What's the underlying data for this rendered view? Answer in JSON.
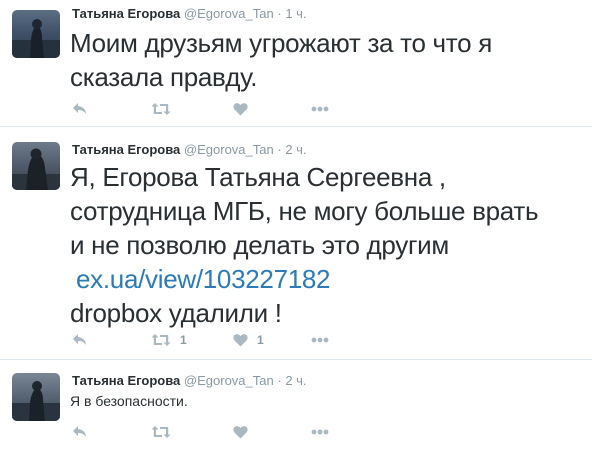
{
  "tweets": [
    {
      "name": "Татьяна Егорова",
      "handle": "@Egorova_Tan",
      "separator": "·",
      "time": "1 ч.",
      "text_lines": [
        "Моим друзьям угрожают за то что я",
        "сказала правду."
      ],
      "link": "",
      "retweets": "",
      "likes": ""
    },
    {
      "name": "Татьяна Егорова",
      "handle": "@Egorova_Tan",
      "separator": "·",
      "time": "2 ч.",
      "text_lines": [
        "Я, Егорова Татьяна Сергеевна ,",
        "сотрудница МГБ, не могу больше врать",
        "и не позволю делать это другим"
      ],
      "link": "ex.ua/view/103227182",
      "text_after_link": "dropbox удалили !",
      "retweets": "1",
      "likes": "1"
    },
    {
      "name": "Татьяна Егорова",
      "handle": "@Egorova_Tan",
      "separator": "·",
      "time": "2 ч.",
      "text_lines": [
        "Я в безопасности."
      ],
      "link": "",
      "retweets": "",
      "likes": ""
    }
  ],
  "icons": {
    "reply": "reply-icon",
    "retweet": "retweet-icon",
    "like": "heart-icon",
    "more": "more-icon"
  },
  "colors": {
    "name": "#292f33",
    "meta": "#8899a6",
    "link": "#2b7bb9",
    "action_icon": "#aab8c2",
    "divider": "#e1e8ed"
  }
}
